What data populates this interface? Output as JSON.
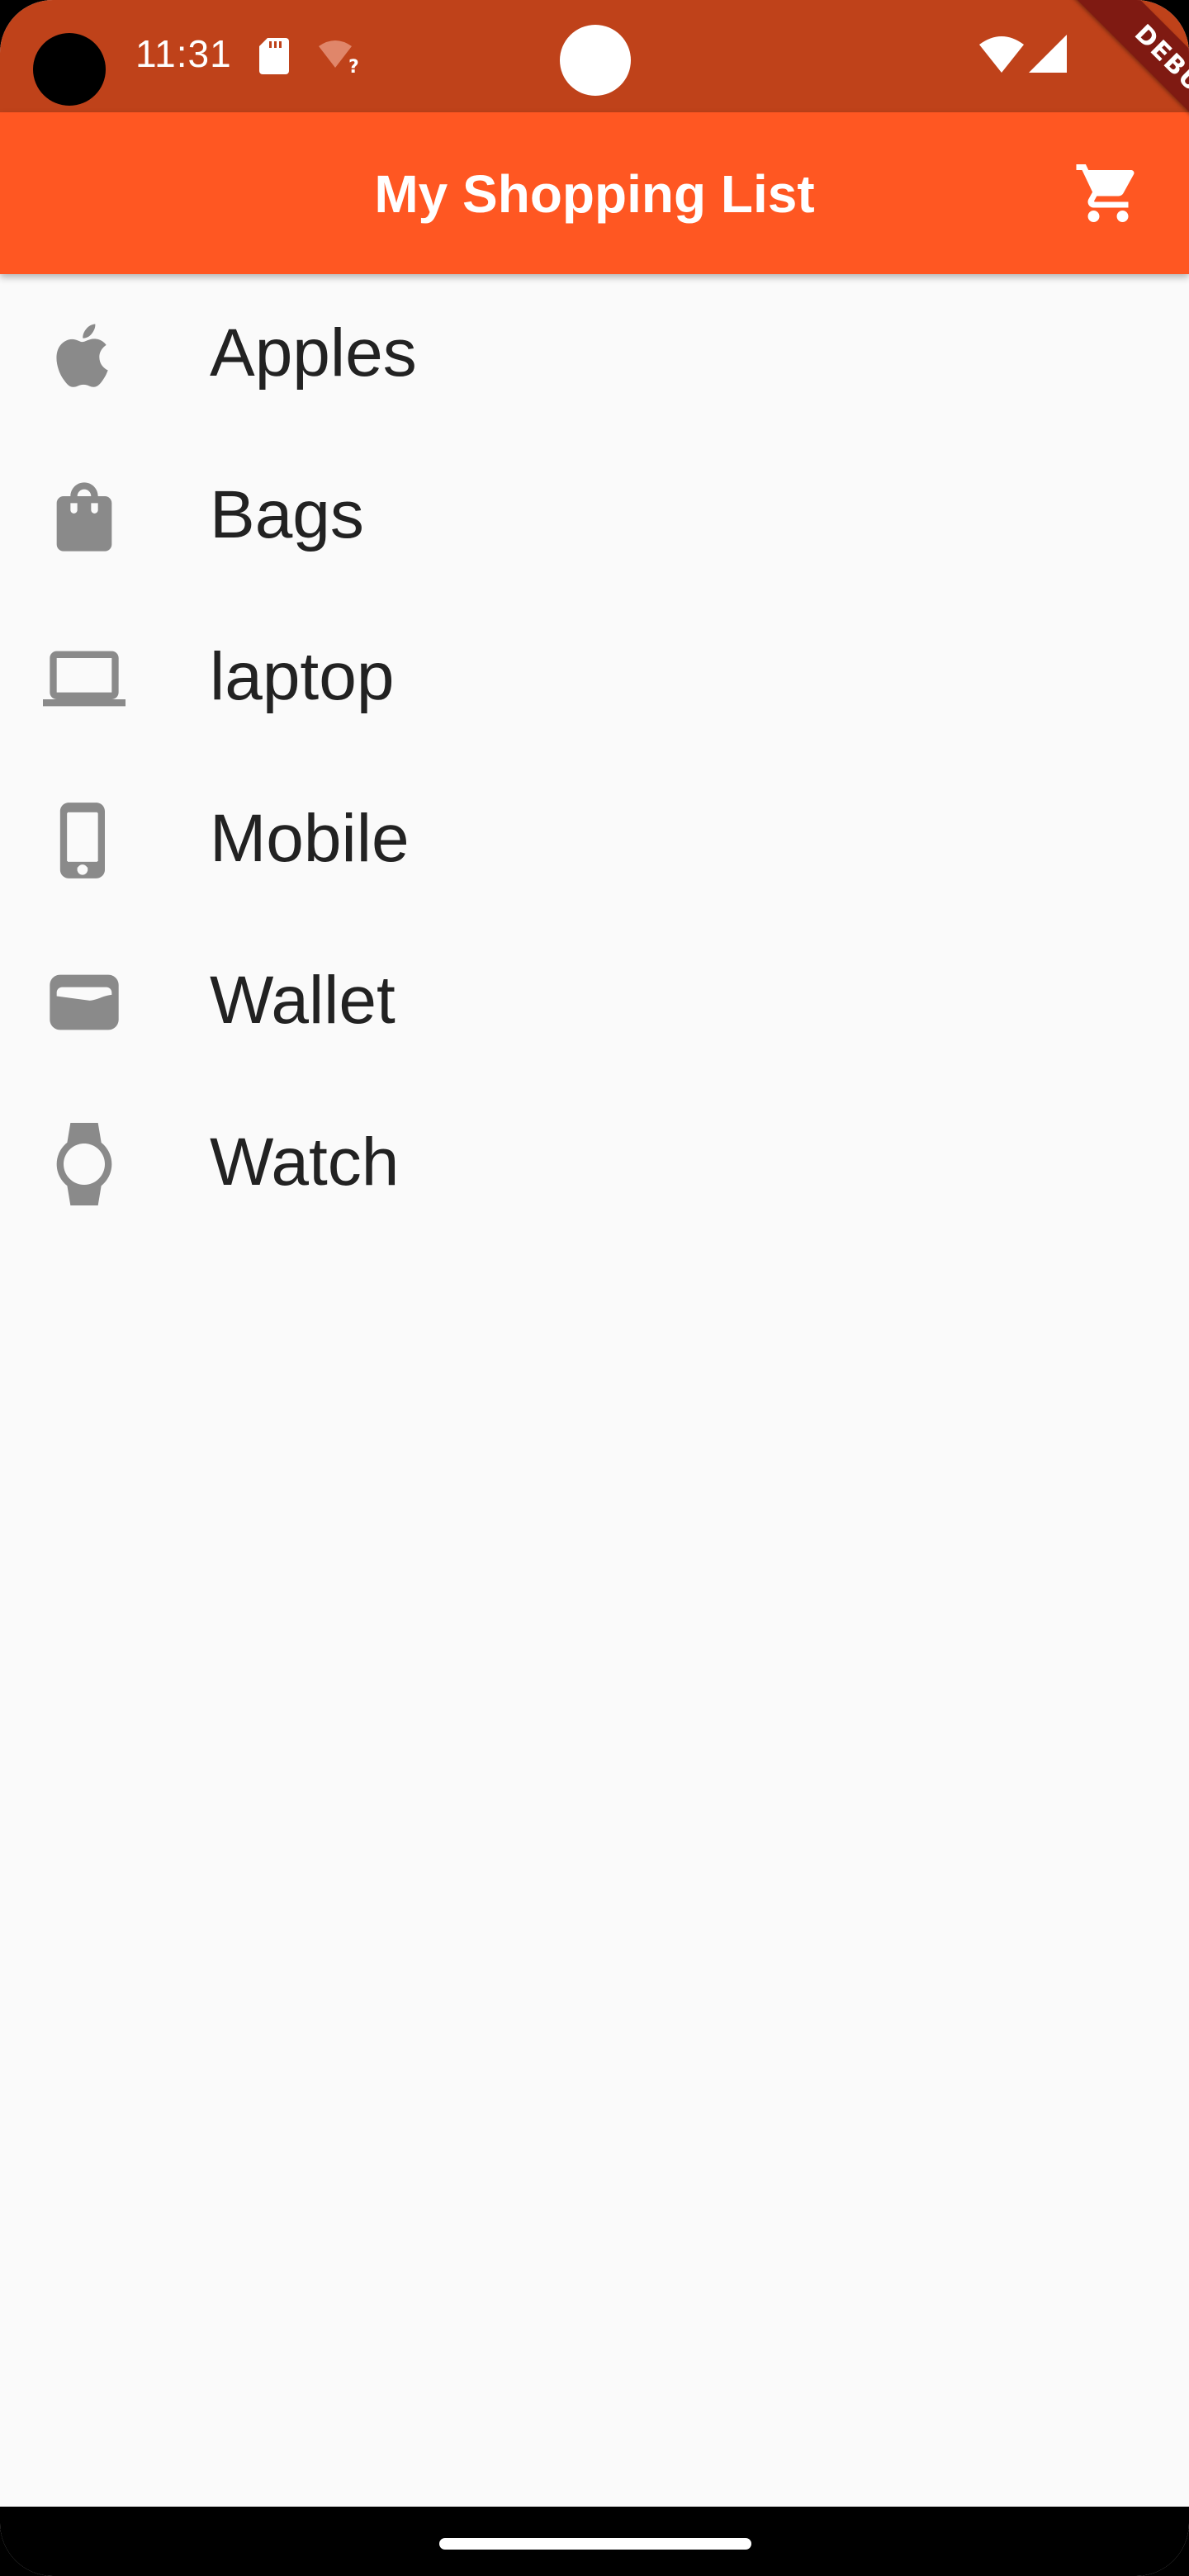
{
  "status_bar": {
    "time": "11:31",
    "icons": [
      "sd-card-icon",
      "wifi-unknown-icon",
      "wifi-icon",
      "cell-signal-icon"
    ]
  },
  "debug_banner": {
    "label": "DEBUG"
  },
  "app_bar": {
    "title": "My Shopping List",
    "action_icon": "shopping-cart-icon"
  },
  "list": {
    "items": [
      {
        "label": "Apples",
        "icon": "apple-icon"
      },
      {
        "label": "Bags",
        "icon": "shopping-bag-icon"
      },
      {
        "label": "laptop",
        "icon": "laptop-icon"
      },
      {
        "label": "Mobile",
        "icon": "phone-icon"
      },
      {
        "label": "Wallet",
        "icon": "wallet-icon"
      },
      {
        "label": "Watch",
        "icon": "watch-icon"
      }
    ]
  },
  "colors": {
    "app_bar": "#ff5722",
    "status_bar": "#bf421a",
    "background": "#fafafa",
    "icon": "#8a8a8a",
    "text": "#222222"
  }
}
